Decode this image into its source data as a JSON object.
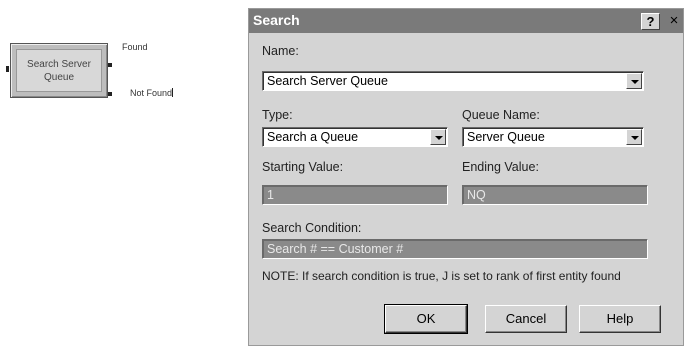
{
  "module": {
    "label": "Search Server\nQueue",
    "exit_found": "Found",
    "exit_not_found": "Not Found"
  },
  "dialog": {
    "title": "Search",
    "help_glyph": "?",
    "close_glyph": "×",
    "name_label": "Name:",
    "name_value": "Search Server Queue",
    "type_label": "Type:",
    "type_value": "Search a Queue",
    "queue_name_label": "Queue Name:",
    "queue_name_value": "Server Queue",
    "starting_value_label": "Starting Value:",
    "starting_value": "1",
    "ending_value_label": "Ending Value:",
    "ending_value": "NQ",
    "search_condition_label": "Search Condition:",
    "search_condition_value": "Search # == Customer #",
    "note": "NOTE: If search condition is true, J is set to rank of first entity found",
    "ok_label": "OK",
    "cancel_label": "Cancel",
    "help_label": "Help"
  },
  "icons": [
    "dropdown-arrow-icon",
    "help-question-icon",
    "close-icon"
  ],
  "colors": {
    "titlebar": "#7a7a7a",
    "dialog_bg": "#d4d4d4",
    "disabled_field": "#8a8a8a",
    "module_fill": "#d8d8d8"
  }
}
